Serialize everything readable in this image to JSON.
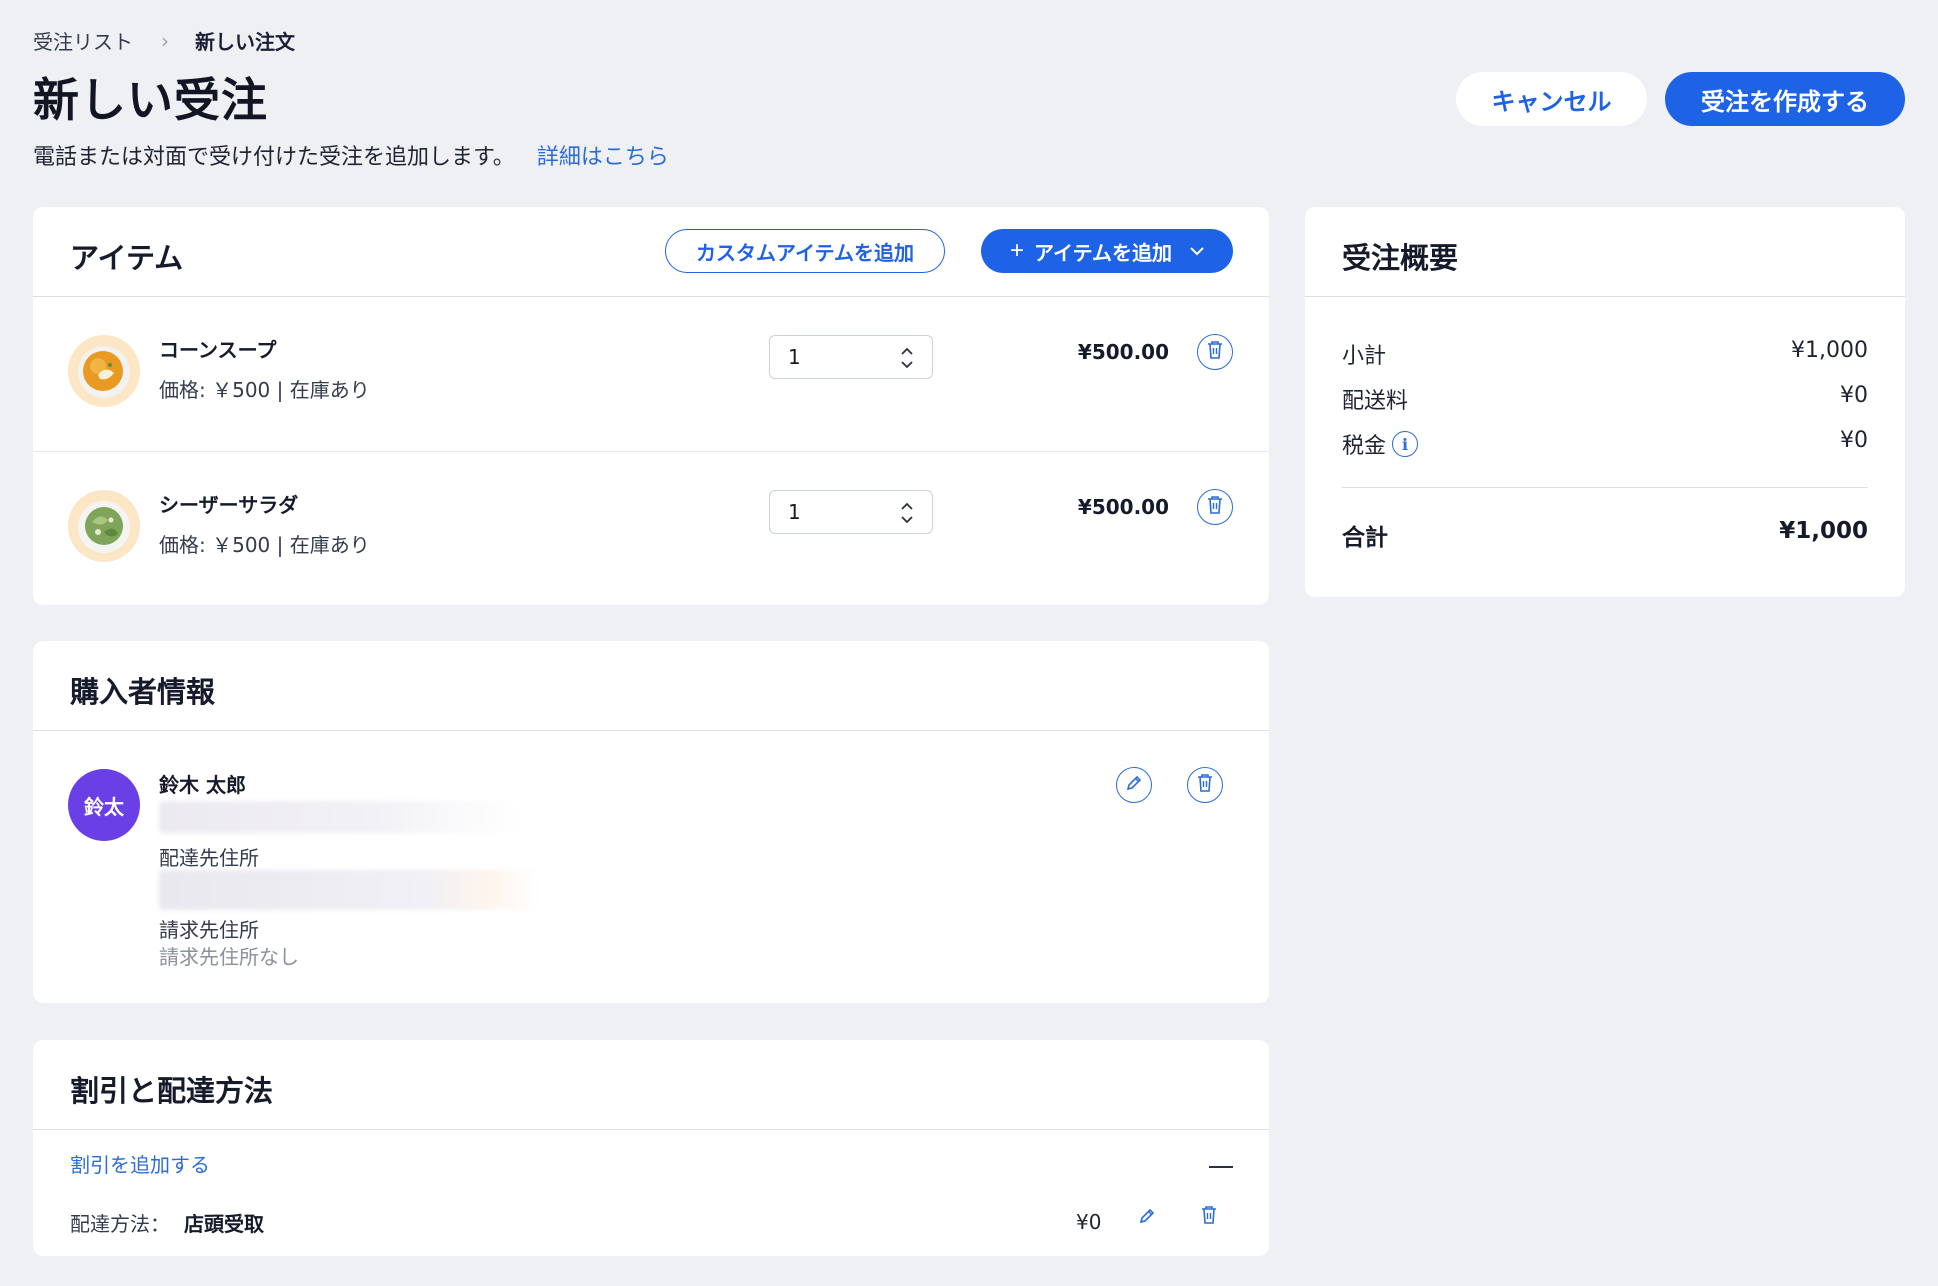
{
  "breadcrumb": {
    "parent": "受注リスト",
    "separator": "›",
    "current": "新しい注文"
  },
  "header": {
    "title": "新しい受注",
    "subtitle": "電話または対面で受け付けた受注を追加します。",
    "learn_more": "詳細はこちら",
    "cancel_label": "キャンセル",
    "create_label": "受注を作成する"
  },
  "items": {
    "title": "アイテム",
    "add_custom_label": "カスタムアイテムを追加",
    "add_item_label": "アイテムを追加",
    "rows": [
      {
        "name": "コーンスープ",
        "meta": "価格: ￥500 | 在庫あり",
        "quantity": "1",
        "price": "¥500.00",
        "thumb_icon": "corn-soup-thumbnail"
      },
      {
        "name": "シーザーサラダ",
        "meta": "価格: ￥500 | 在庫あり",
        "quantity": "1",
        "price": "¥500.00",
        "thumb_icon": "caesar-salad-thumbnail"
      }
    ]
  },
  "summary": {
    "title": "受注概要",
    "subtotal_label": "小計",
    "subtotal_value": "¥1,000",
    "shipping_label": "配送料",
    "shipping_value": "¥0",
    "tax_label": "税金",
    "tax_value": "¥0",
    "total_label": "合計",
    "total_value": "¥1,000"
  },
  "buyer": {
    "title": "購入者情報",
    "avatar_initials": "鈴太",
    "name": "鈴木 太郎",
    "shipping_address_label": "配達先住所",
    "billing_address_label": "請求先住所",
    "billing_address_empty": "請求先住所なし"
  },
  "discount": {
    "title": "割引と配達方法",
    "add_discount_label": "割引を追加する",
    "delivery_label": "配達方法：",
    "delivery_value": "店頭受取",
    "delivery_price": "¥0"
  },
  "colors": {
    "primary": "#1e62e5",
    "link": "#2b6cd8",
    "avatar": "#6a3fe6",
    "background": "#eef0f3"
  }
}
